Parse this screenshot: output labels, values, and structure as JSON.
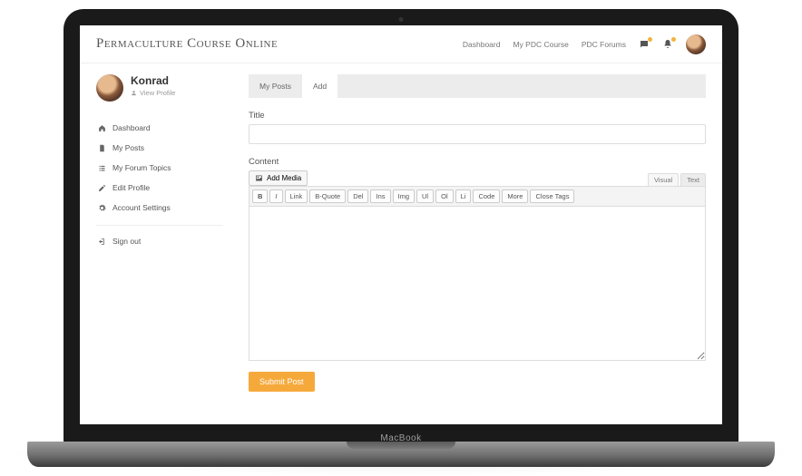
{
  "header": {
    "site_title": "Permaculture Course Online",
    "nav": {
      "dashboard": "Dashboard",
      "my_course": "My PDC Course",
      "forums": "PDC Forums"
    }
  },
  "sidebar": {
    "user_name": "Konrad",
    "view_profile": "View Profile",
    "items": [
      {
        "label": "Dashboard"
      },
      {
        "label": "My Posts"
      },
      {
        "label": "My Forum Topics"
      },
      {
        "label": "Edit Profile"
      },
      {
        "label": "Account Settings"
      }
    ],
    "signout": "Sign out"
  },
  "main": {
    "tabs": {
      "my_posts": "My Posts",
      "add": "Add"
    },
    "title_label": "Title",
    "title_value": "",
    "content_label": "Content",
    "add_media": "Add Media",
    "editor_tabs": {
      "visual": "Visual",
      "text": "Text"
    },
    "toolbar": [
      "B",
      "I",
      "Link",
      "B-Quote",
      "Del",
      "Ins",
      "Img",
      "Ul",
      "Ol",
      "Li",
      "Code",
      "More",
      "Close Tags"
    ],
    "content_value": "",
    "submit": "Submit Post"
  },
  "device": {
    "brand": "MacBook"
  }
}
